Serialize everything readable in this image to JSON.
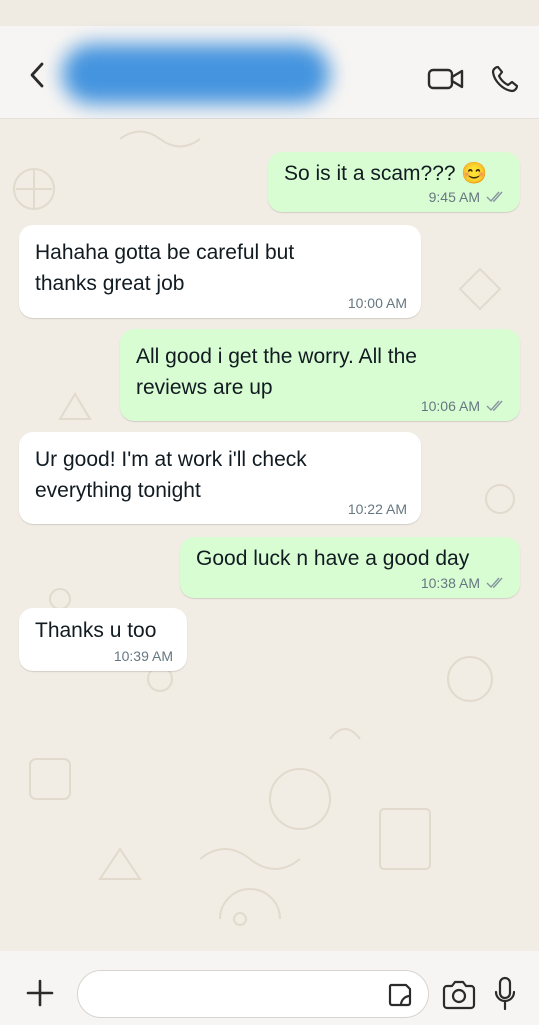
{
  "header": {
    "contact_name": "",
    "icons": [
      "back-chevron-icon",
      "video-call-icon",
      "voice-call-icon"
    ]
  },
  "messages": [
    {
      "direction": "out",
      "text": "So is it a scam??? 😊",
      "time": "9:45 AM",
      "read": true
    },
    {
      "direction": "in",
      "text": "Hahaha gotta be careful but\nthanks great job",
      "time": "10:00 AM"
    },
    {
      "direction": "out",
      "text": "All good i get the worry. All the\nreviews are up",
      "time": "10:06 AM",
      "read": true
    },
    {
      "direction": "in",
      "text": "Ur good! I'm at work i'll check\neverything tonight",
      "time": "10:22 AM"
    },
    {
      "direction": "out",
      "text": "Good luck n have a good day",
      "time": "10:38 AM",
      "read": true
    },
    {
      "direction": "in",
      "text": "Thanks u too",
      "time": "10:39 AM"
    }
  ],
  "composer": {
    "value": "",
    "icons": [
      "plus-icon",
      "sticker-icon",
      "camera-icon",
      "microphone-icon"
    ]
  },
  "colors": {
    "incoming_bubble": "#ffffff",
    "outgoing_bubble": "#d9fdd3",
    "wallpaper": "#f1ece4",
    "timestamp": "#667781"
  }
}
